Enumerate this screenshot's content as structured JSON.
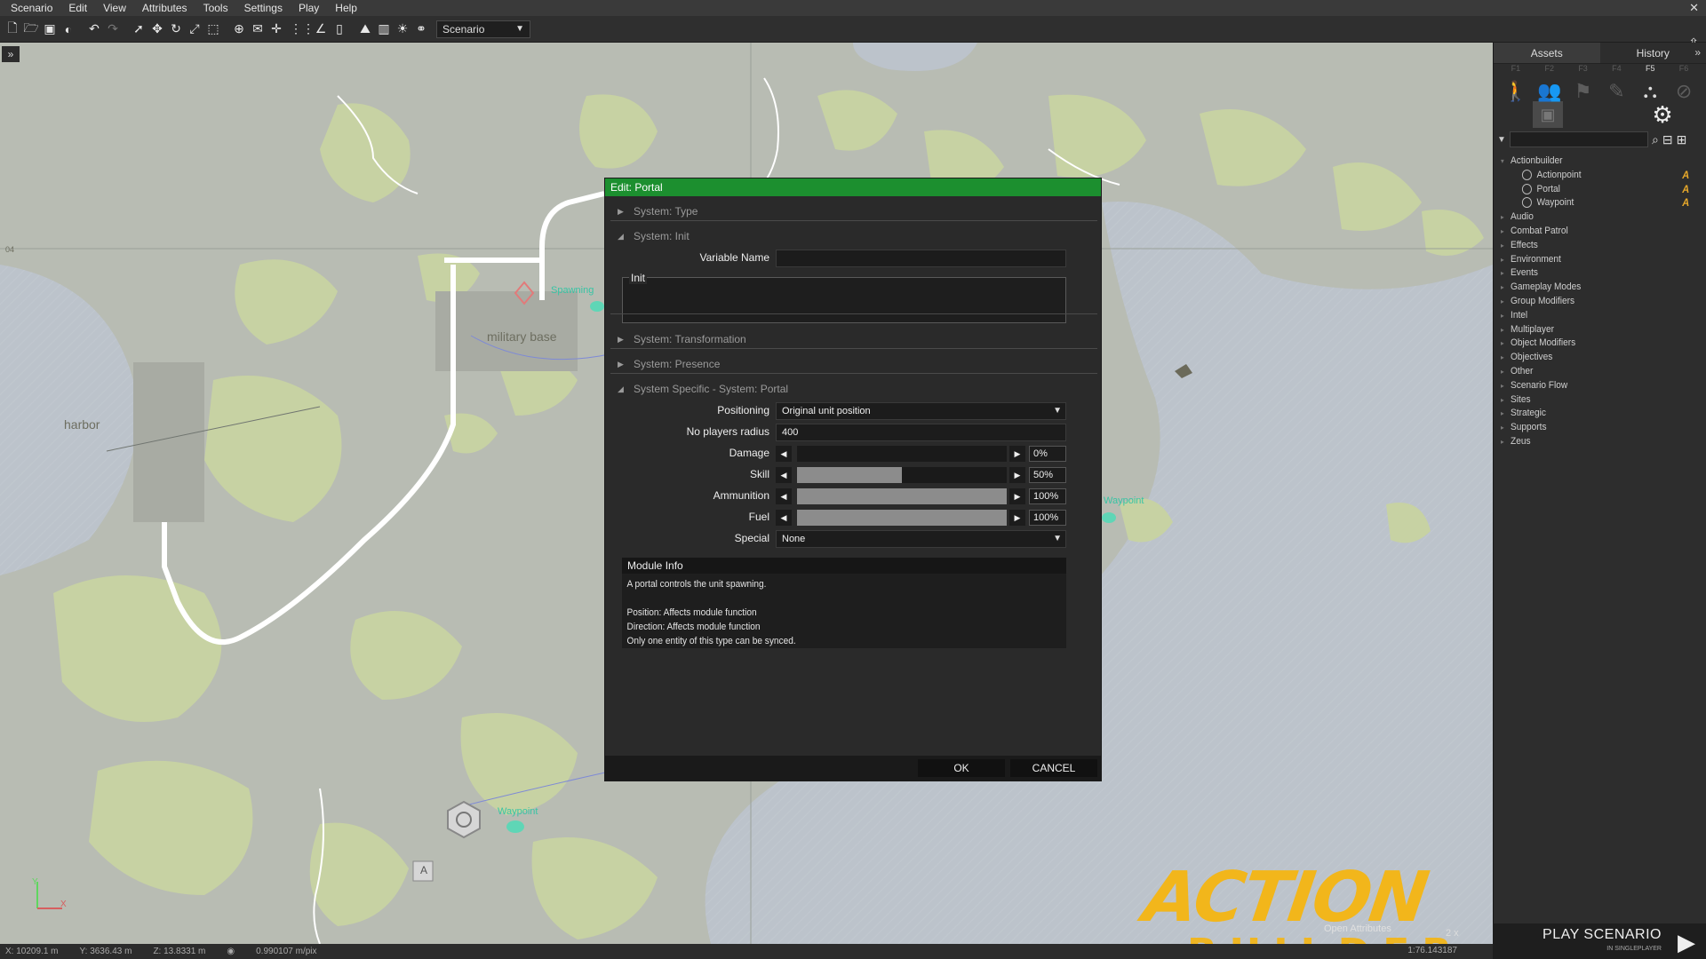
{
  "menu": {
    "items": [
      "Scenario",
      "Edit",
      "View",
      "Attributes",
      "Tools",
      "Settings",
      "Play",
      "Help"
    ]
  },
  "toolbar": {
    "scenario_select": "Scenario"
  },
  "map": {
    "labels": {
      "harbor": "harbor",
      "military_base": "military base",
      "spawning": "Spawning",
      "waypoint": "Waypoint",
      "waypoint_right": "Waypoint",
      "grid_04": "04"
    },
    "axis": {
      "y": "Y",
      "x": "X"
    }
  },
  "statusbar": {
    "x": "10209.1 m",
    "y": "3636.43 m",
    "z": "13.8331 m",
    "scale": "0.990107 m/pix",
    "zoom": "1:76.143187"
  },
  "overlay": {
    "open_attributes": "Open Attributes",
    "zoom": "2 x"
  },
  "right_panel": {
    "tabs": {
      "assets": "Assets",
      "history": "History"
    },
    "fkeys": [
      "F1",
      "F2",
      "F3",
      "F4",
      "F5",
      "F6"
    ],
    "search_placeholder": "",
    "tree": [
      {
        "label": "Actionbuilder",
        "expanded": true,
        "children": [
          {
            "label": "Actionpoint"
          },
          {
            "label": "Portal"
          },
          {
            "label": "Waypoint"
          }
        ]
      },
      {
        "label": "Audio"
      },
      {
        "label": "Combat Patrol"
      },
      {
        "label": "Effects"
      },
      {
        "label": "Environment"
      },
      {
        "label": "Events"
      },
      {
        "label": "Gameplay Modes"
      },
      {
        "label": "Group Modifiers"
      },
      {
        "label": "Intel"
      },
      {
        "label": "Multiplayer"
      },
      {
        "label": "Object Modifiers"
      },
      {
        "label": "Objectives"
      },
      {
        "label": "Other"
      },
      {
        "label": "Scenario Flow"
      },
      {
        "label": "Sites"
      },
      {
        "label": "Strategic"
      },
      {
        "label": "Supports"
      },
      {
        "label": "Zeus"
      }
    ],
    "badge": "A"
  },
  "play": {
    "title": "PLAY SCENARIO",
    "sub": "IN SINGLEPLAYER"
  },
  "logo": {
    "line1": "ACTION",
    "line2": "BUILDER"
  },
  "dialog": {
    "title": "Edit: Portal",
    "sections": {
      "type": "System: Type",
      "init": "System: Init",
      "transformation": "System: Transformation",
      "presence": "System: Presence",
      "specific": "System Specific - System: Portal"
    },
    "init": {
      "variable_name_label": "Variable Name",
      "variable_name_value": "",
      "init_label": "Init",
      "init_value": ""
    },
    "portal": {
      "positioning_label": "Positioning",
      "positioning_value": "Original unit position",
      "radius_label": "No players radius",
      "radius_value": "400",
      "damage_label": "Damage",
      "damage_value": "0%",
      "damage": 0,
      "skill_label": "Skill",
      "skill_value": "50%",
      "skill": 0.5,
      "ammo_label": "Ammunition",
      "ammo_value": "100%",
      "ammo": 1.0,
      "fuel_label": "Fuel",
      "fuel_value": "100%",
      "fuel": 1.0,
      "special_label": "Special",
      "special_value": "None"
    },
    "module_info": {
      "header": "Module Info",
      "lines": [
        "A portal controls the unit spawning.",
        "",
        "Position: Affects module function",
        "Direction: Affects module function",
        "Only one entity of this type can be synced."
      ]
    },
    "buttons": {
      "ok": "OK",
      "cancel": "CANCEL"
    }
  },
  "colors": {
    "title_green": "#1c8f2f",
    "land_green": "#c7d2a3",
    "water": "#bcc3cb",
    "logo_yellow": "#f2b61b"
  }
}
